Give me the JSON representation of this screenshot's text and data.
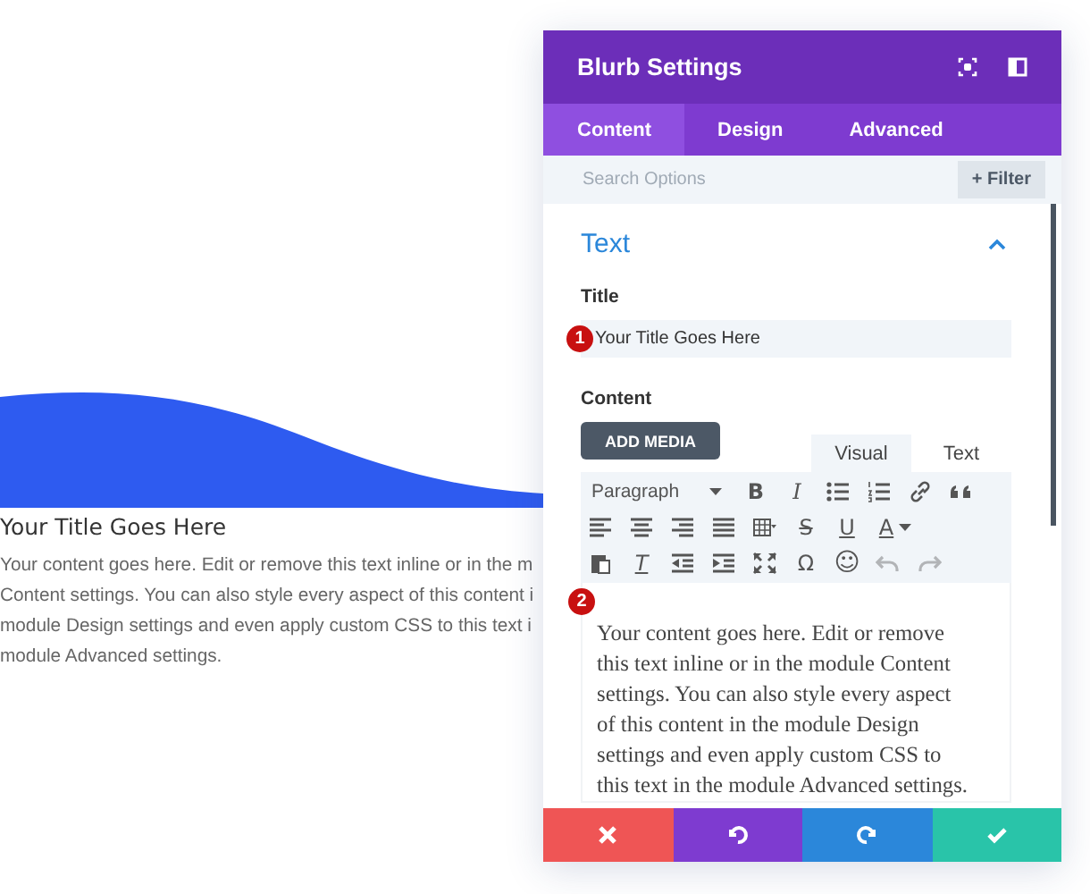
{
  "page": {
    "title": "Your Title Goes Here",
    "paragraph_lines": [
      "Your content goes here. Edit or remove this text inline or in the m",
      "Content settings. You can also style every aspect of this content i",
      "module Design settings and even apply custom CSS to this text i",
      "module Advanced settings."
    ]
  },
  "panel": {
    "title": "Blurb Settings",
    "tabs": [
      {
        "label": "Content",
        "selected": true
      },
      {
        "label": "Design",
        "selected": false
      },
      {
        "label": "Advanced",
        "selected": false
      }
    ],
    "search": {
      "placeholder": "Search Options"
    },
    "filter_button": {
      "icon": "+",
      "label": "Filter"
    },
    "section": {
      "title": "Text",
      "expanded": true
    },
    "title_field": {
      "label": "Title",
      "badge": "1",
      "value": "Your Title Goes Here"
    },
    "content_field": {
      "label": "Content",
      "add_media": "ADD MEDIA",
      "editor_tabs": [
        {
          "label": "Visual",
          "selected": true
        },
        {
          "label": "Text",
          "selected": false
        }
      ],
      "toolbar": [
        [
          {
            "kind": "dropdown",
            "label": "Paragraph"
          },
          {
            "kind": "bold",
            "label": "B"
          },
          {
            "kind": "italic",
            "label": "I"
          },
          {
            "kind": "bullet-list"
          },
          {
            "kind": "numbered-list"
          },
          {
            "kind": "link"
          },
          {
            "kind": "quote"
          }
        ],
        [
          {
            "kind": "align-left"
          },
          {
            "kind": "align-center"
          },
          {
            "kind": "align-right"
          },
          {
            "kind": "justify"
          },
          {
            "kind": "table"
          },
          {
            "kind": "strike",
            "label": "S"
          },
          {
            "kind": "underline",
            "label": "U"
          },
          {
            "kind": "color",
            "label": "A"
          }
        ],
        [
          {
            "kind": "paste"
          },
          {
            "kind": "clear",
            "label": "T"
          },
          {
            "kind": "outdent"
          },
          {
            "kind": "indent"
          },
          {
            "kind": "fullscreen"
          },
          {
            "kind": "symbol",
            "label": "Ω"
          },
          {
            "kind": "emoji",
            "label": "☺"
          },
          {
            "kind": "undo",
            "disabled": true
          },
          {
            "kind": "redo",
            "disabled": true
          }
        ]
      ],
      "badge": "2",
      "text": "Your content goes here. Edit or remove this text inline or in the module Content settings. You can also style every aspect of this content in the module Design settings and even apply custom CSS to this text in the module Advanced settings."
    },
    "footer_buttons": [
      {
        "kind": "cancel"
      },
      {
        "kind": "undo"
      },
      {
        "kind": "redo"
      },
      {
        "kind": "save"
      }
    ]
  }
}
